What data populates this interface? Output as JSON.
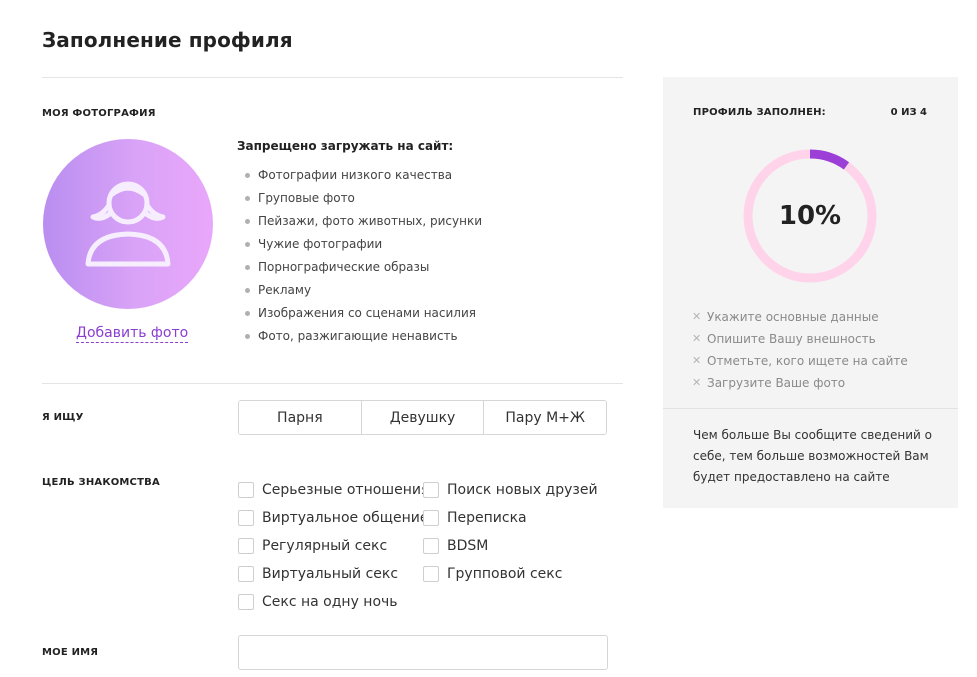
{
  "page": {
    "title": "Заполнение профиля"
  },
  "photo": {
    "label": "МОЯ ФОТОГРАФИЯ",
    "add_link": "Добавить фото",
    "rules_title": "Запрещено загружать на сайт:",
    "rules": [
      "Фотографии низкого качества",
      "Груповые фото",
      "Пейзажи, фото животных, рисунки",
      "Чужие фотографии",
      "Порнографические образы",
      "Рекламу",
      "Изображения со сценами насилия",
      "Фото, разжигающие ненависть"
    ]
  },
  "seeking": {
    "label": "Я ИЩУ",
    "options": [
      "Парня",
      "Девушку",
      "Пару М+Ж"
    ]
  },
  "goal": {
    "label": "ЦЕЛЬ ЗНАКОМСТВА",
    "left": [
      "Серьезные отношения",
      "Виртуальное общение",
      "Регулярный секс",
      "Виртуальный секс",
      "Секс на одну ночь"
    ],
    "right": [
      "Поиск новых друзей",
      "Переписка",
      "BDSM",
      "Групповой секс"
    ]
  },
  "name": {
    "label": "МОЕ ИМЯ",
    "value": ""
  },
  "progress": {
    "heading": "ПРОФИЛЬ ЗАПОЛНЕН:",
    "count": "0 ИЗ 4",
    "percent_label": "10%",
    "percent": 0.1,
    "tasks": [
      "Укажите основные данные",
      "Опишите Вашу внешность",
      "Отметьте, кого ищете на сайте",
      "Загрузите Ваше фото"
    ],
    "note": "Чем больше Вы сообщите сведений о себе, тем больше возможностей Вам будет предоставлено на сайте"
  },
  "colors": {
    "accent": "#8b3dd0",
    "ring_fill": "#9b3fd6",
    "ring_track": "#ffd3ea",
    "panel_bg": "#f4f4f4"
  }
}
